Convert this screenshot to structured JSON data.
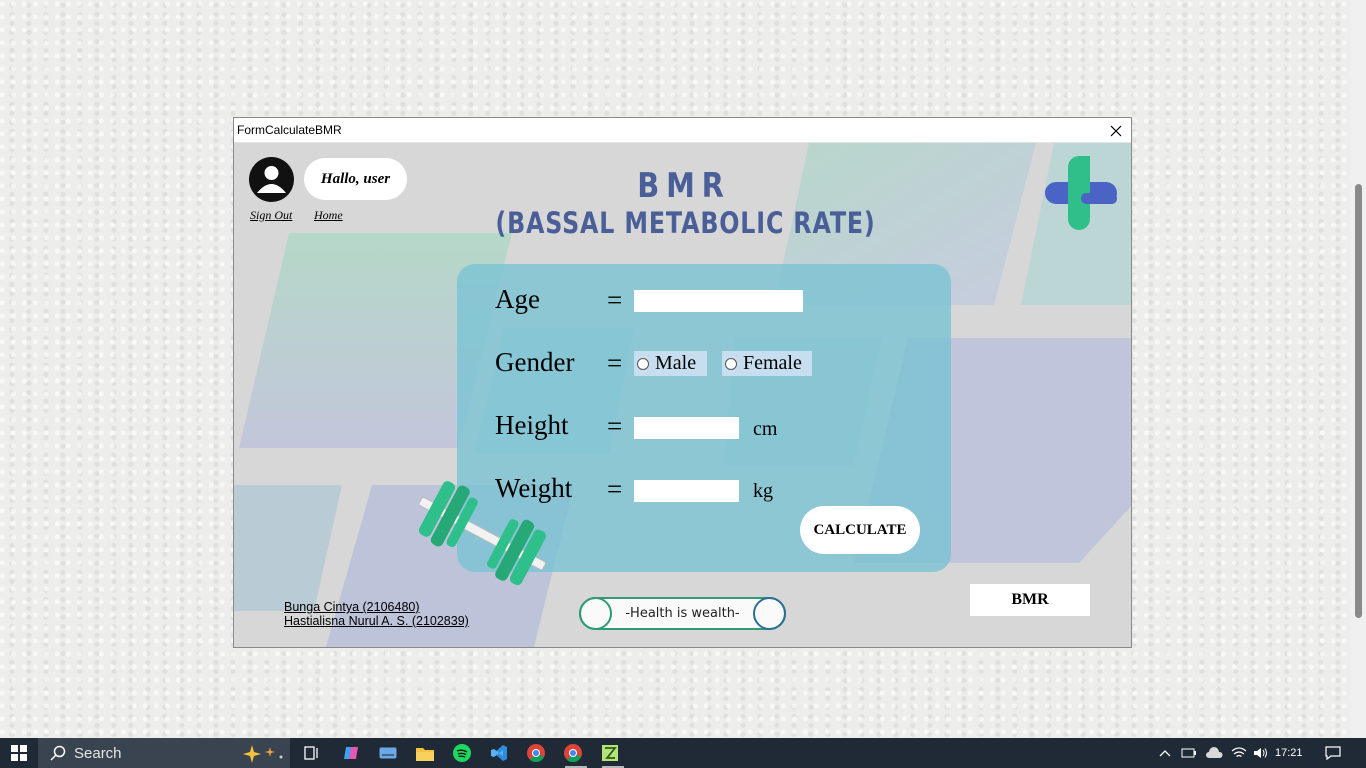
{
  "window": {
    "title": "FormCalculateBMR"
  },
  "header": {
    "greeting": "Hallo, user",
    "sign_out": "Sign Out",
    "home": "Home",
    "title": "BMR",
    "subtitle": "(BASSAL METABOLIC RATE)"
  },
  "form": {
    "age_label": "Age",
    "age_value": "",
    "gender_label": "Gender",
    "gender_options": [
      "Male",
      "Female"
    ],
    "gender_selected": "",
    "height_label": "Height",
    "height_value": "",
    "height_unit": "cm",
    "weight_label": "Weight",
    "weight_value": "",
    "weight_unit": "kg",
    "equals": "=",
    "calculate_label": "CALCULATE",
    "bmr_label": "BMR"
  },
  "footer": {
    "credits": [
      "Bunga Cintya (2106480)",
      "Hastialisna Nurul A. S. (2102839)"
    ],
    "motto": "-Health is wealth-"
  },
  "taskbar": {
    "search_label": "Search",
    "time": "17:21",
    "apps": [
      "task-view",
      "copilot",
      "keyboard",
      "file-explorer",
      "spotify",
      "vscode",
      "chrome",
      "chrome-active",
      "notepad-plus"
    ]
  },
  "colors": {
    "title": "#4a5f98",
    "panel": "#78c3d4",
    "accent_green": "#2fbf8a",
    "accent_blue": "#4b63c4"
  }
}
